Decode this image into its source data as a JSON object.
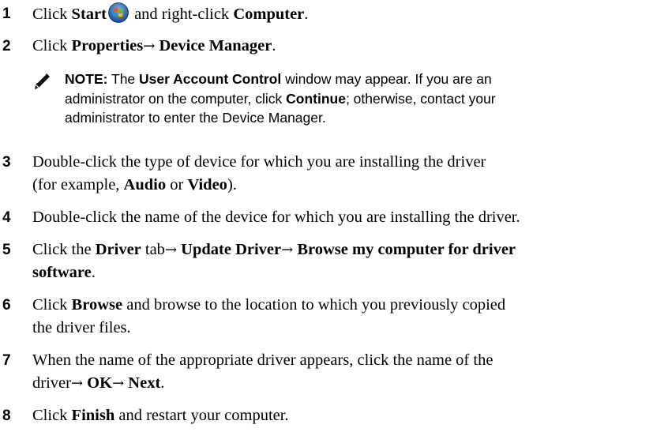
{
  "steps": [
    {
      "number": "1",
      "parts": [
        {
          "text": "Click ",
          "bold": false
        },
        {
          "text": "Start",
          "bold": true
        },
        {
          "icon": "windows-start-icon"
        },
        {
          "text": " and right-click ",
          "bold": false
        },
        {
          "text": "Computer",
          "bold": true
        },
        {
          "text": ".",
          "bold": false
        }
      ]
    },
    {
      "number": "2",
      "parts": [
        {
          "text": "Click ",
          "bold": false
        },
        {
          "text": "Properties",
          "bold": true
        },
        {
          "text": "→",
          "arrow": true
        },
        {
          "text": " ",
          "bold": false
        },
        {
          "text": "Device Manager",
          "bold": true
        },
        {
          "text": ".",
          "bold": false
        }
      ]
    },
    {
      "number": "3",
      "parts": [
        {
          "text": "Double-click the type of device for which you are installing the driver",
          "bold": false
        },
        {
          "br": true
        },
        {
          "text": "(for example, ",
          "bold": false
        },
        {
          "text": "Audio",
          "bold": true
        },
        {
          "text": " or ",
          "bold": false
        },
        {
          "text": "Video",
          "bold": true
        },
        {
          "text": ").",
          "bold": false
        }
      ]
    },
    {
      "number": "4",
      "parts": [
        {
          "text": "Double-click the name of the device for which you are installing the driver.",
          "bold": false
        }
      ]
    },
    {
      "number": "5",
      "parts": [
        {
          "text": "Click the ",
          "bold": false
        },
        {
          "text": "Driver",
          "bold": true
        },
        {
          "text": " tab",
          "bold": false
        },
        {
          "text": "→",
          "arrow": true
        },
        {
          "text": " ",
          "bold": false
        },
        {
          "text": "Update Driver",
          "bold": true
        },
        {
          "text": "→",
          "arrow": true
        },
        {
          "text": " ",
          "bold": false
        },
        {
          "text": "Browse my computer for driver",
          "bold": true
        },
        {
          "br": true
        },
        {
          "text": "software",
          "bold": true
        },
        {
          "text": ".",
          "bold": false
        }
      ]
    },
    {
      "number": "6",
      "parts": [
        {
          "text": "Click ",
          "bold": false
        },
        {
          "text": "Browse",
          "bold": true
        },
        {
          "text": " and browse to the location to which you previously copied",
          "bold": false
        },
        {
          "br": true
        },
        {
          "text": "the driver files.",
          "bold": false
        }
      ]
    },
    {
      "number": "7",
      "parts": [
        {
          "text": "When the name of the appropriate driver appears, click the name of the",
          "bold": false
        },
        {
          "br": true
        },
        {
          "text": "driver",
          "bold": false
        },
        {
          "text": "→",
          "arrow": true
        },
        {
          "text": " ",
          "bold": false
        },
        {
          "text": "OK",
          "bold": true
        },
        {
          "text": "→",
          "arrow": true
        },
        {
          "text": " ",
          "bold": false
        },
        {
          "text": "Next",
          "bold": true
        },
        {
          "text": ".",
          "bold": false
        }
      ]
    },
    {
      "number": "8",
      "parts": [
        {
          "text": "Click ",
          "bold": false
        },
        {
          "text": "Finish",
          "bold": true
        },
        {
          "text": " and restart your computer.",
          "bold": false
        }
      ]
    }
  ],
  "note": {
    "icon": "pencil-note-icon",
    "parts": [
      {
        "text": "NOTE:",
        "bold": true
      },
      {
        "text": " The ",
        "bold": false
      },
      {
        "text": "User Account Control",
        "bold": true
      },
      {
        "text": " window may appear. If you are an",
        "bold": false
      },
      {
        "br": true
      },
      {
        "text": "administrator on the computer, click ",
        "bold": false
      },
      {
        "text": "Continue",
        "bold": true
      },
      {
        "text": "; otherwise, contact your",
        "bold": false
      },
      {
        "br": true
      },
      {
        "text": "administrator to enter the Device Manager.",
        "bold": false
      }
    ]
  }
}
